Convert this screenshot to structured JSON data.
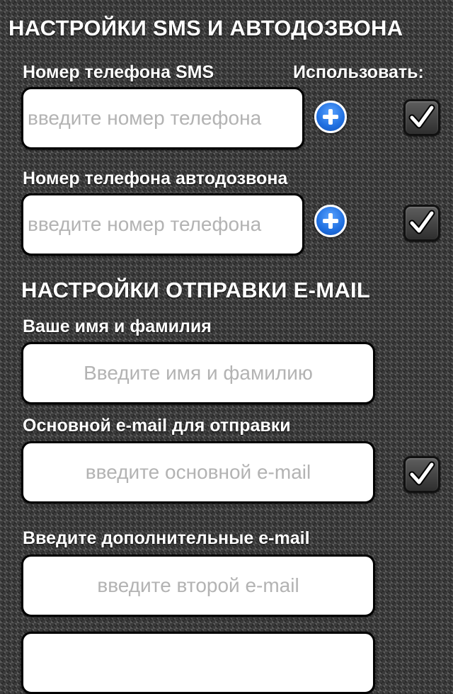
{
  "sms_section": {
    "title": "НАСТРОЙКИ SMS И АВТОДОЗВОНА",
    "sms_phone_label": "Номер телефона SMS",
    "use_label": "Использовать:",
    "sms_phone_placeholder": "введите номер телефона",
    "sms_use_checked": true,
    "autodial_phone_label": "Номер телефона автодозвона",
    "autodial_phone_placeholder": "введите номер телефона",
    "autodial_use_checked": true
  },
  "email_section": {
    "title": "НАСТРОЙКИ ОТПРАВКИ E-MAIL",
    "name_label": "Ваше имя и фамилия",
    "name_placeholder": "Введите имя и фамилию",
    "primary_email_label": "Основной e-mail для отправки",
    "primary_email_placeholder": "введите основной e-mail",
    "primary_email_checked": true,
    "additional_emails_label": "Введите дополнительные e-mail",
    "second_email_placeholder": "введите второй e-mail",
    "third_email_placeholder": ""
  },
  "icons": {
    "add": "plus-circle-icon",
    "check": "checkmark-icon"
  },
  "colors": {
    "accent_blue": "#1f6fe0",
    "label_text": "#ffffff",
    "placeholder": "#b3b3b3"
  }
}
